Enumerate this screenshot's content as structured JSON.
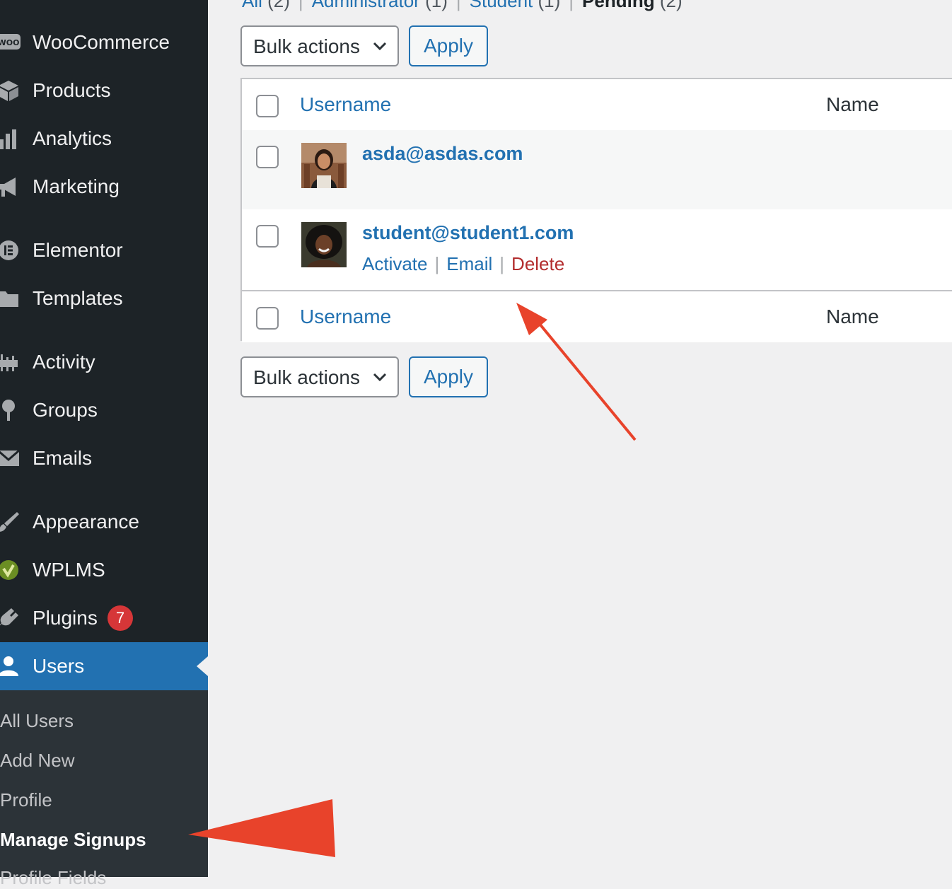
{
  "sidebar": {
    "menu": [
      {
        "label": "WooCommerce",
        "icon": "woo-icon"
      },
      {
        "label": "Products",
        "icon": "box-icon"
      },
      {
        "label": "Analytics",
        "icon": "bar-chart-icon"
      },
      {
        "label": "Marketing",
        "icon": "megaphone-icon"
      },
      {
        "label": "Elementor",
        "icon": "elementor-icon"
      },
      {
        "label": "Templates",
        "icon": "folder-icon"
      },
      {
        "label": "Activity",
        "icon": "activity-icon"
      },
      {
        "label": "Groups",
        "icon": "groups-icon"
      },
      {
        "label": "Emails",
        "icon": "envelope-icon"
      },
      {
        "label": "Appearance",
        "icon": "paintbrush-icon"
      },
      {
        "label": "WPLMS",
        "icon": "wplms-icon"
      },
      {
        "label": "Plugins",
        "icon": "plug-icon",
        "badge": "7"
      },
      {
        "label": "Users",
        "icon": "user-icon",
        "active": true
      }
    ],
    "submenu": [
      {
        "label": "All Users"
      },
      {
        "label": "Add New"
      },
      {
        "label": "Profile"
      },
      {
        "label": "Manage Signups",
        "current": true
      },
      {
        "label": "Profile Fields"
      }
    ]
  },
  "views": {
    "all": {
      "label": "All",
      "count": "(2)"
    },
    "administrator": {
      "label": "Administrator",
      "count": "(1)"
    },
    "student": {
      "label": "Student",
      "count": "(1)"
    },
    "pending": {
      "label": "Pending",
      "count": "(2)"
    }
  },
  "bulk": {
    "select_label": "Bulk actions",
    "apply_label": "Apply"
  },
  "table": {
    "columns": {
      "username": "Username",
      "name": "Name"
    },
    "rows": [
      {
        "username": "asda@asdas.com"
      },
      {
        "username": "student@student1.com",
        "actions": {
          "activate": "Activate",
          "email": "Email",
          "delete": "Delete"
        }
      }
    ]
  },
  "colors": {
    "sidebar_bg": "#1d2327",
    "active_bg": "#2271b1",
    "link": "#2271b1",
    "delete": "#b32d2e",
    "badge": "#d63638",
    "annotation_arrow": "#e8432b"
  }
}
